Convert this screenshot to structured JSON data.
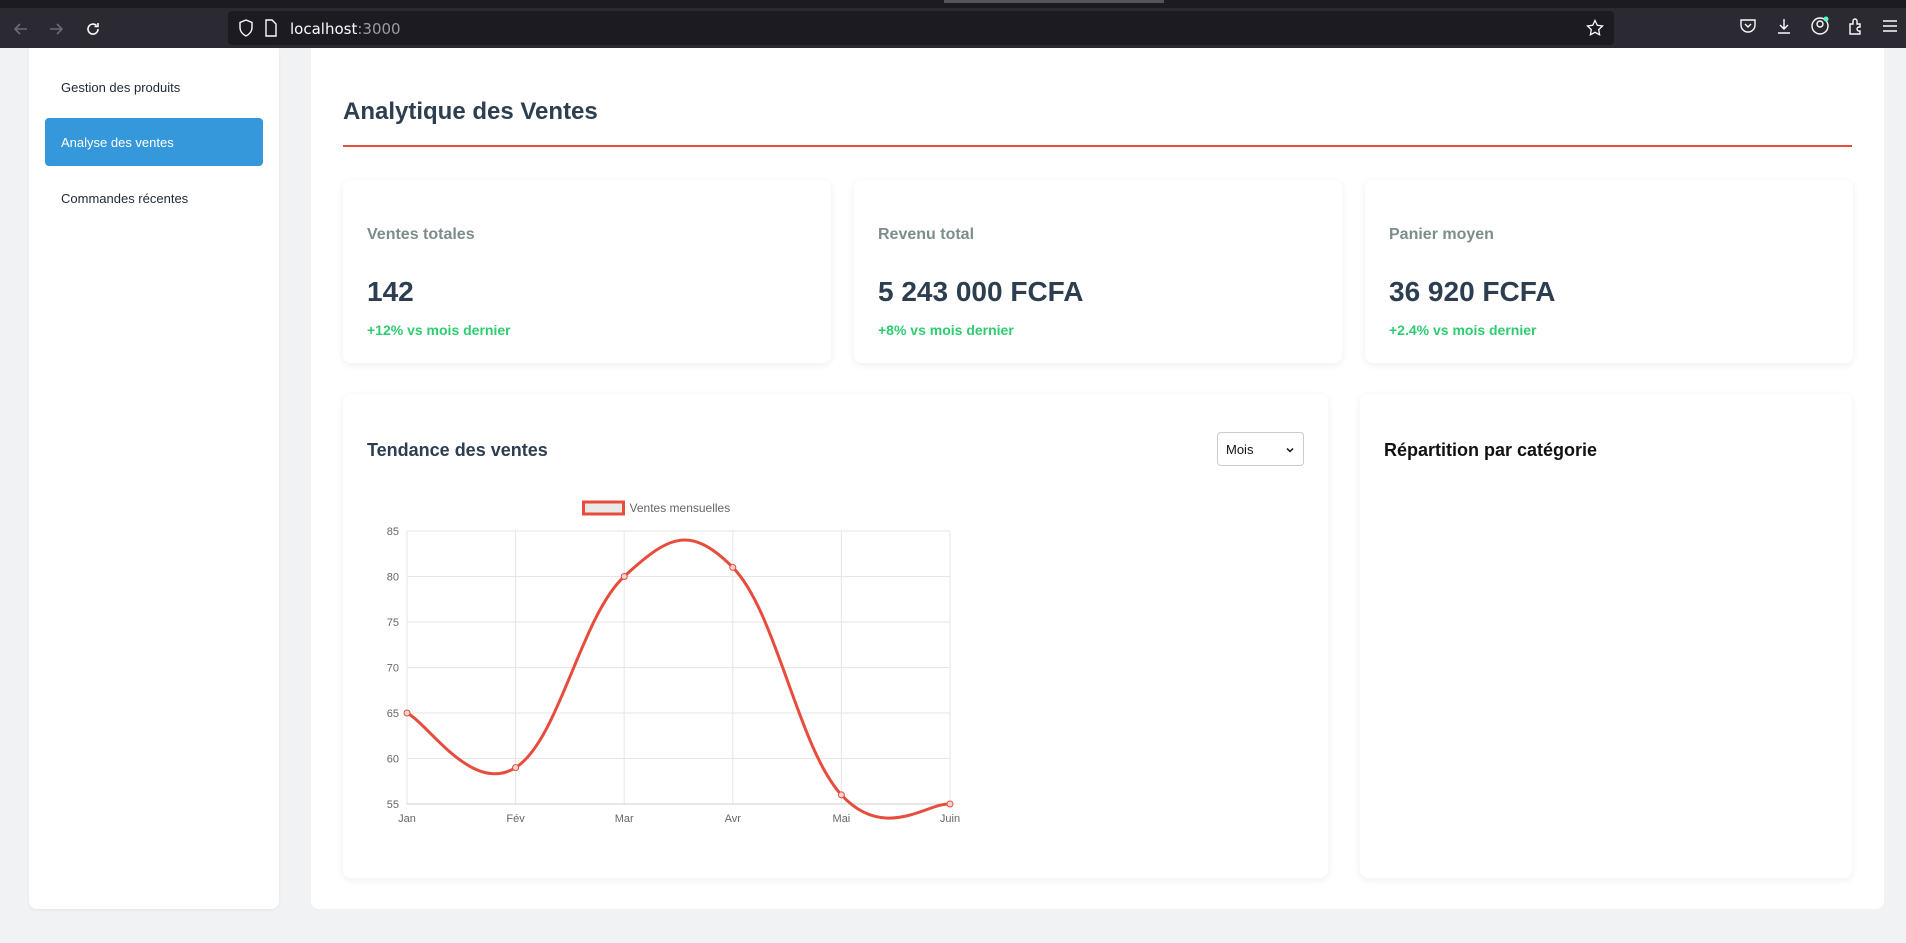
{
  "browser": {
    "url_host": "localhost",
    "url_port": ":3000"
  },
  "sidebar": {
    "items": [
      {
        "label": "Gestion des produits",
        "active": false
      },
      {
        "label": "Analyse des ventes",
        "active": true
      },
      {
        "label": "Commandes récentes",
        "active": false
      }
    ]
  },
  "main": {
    "title": "Analytique des Ventes",
    "stats": [
      {
        "label": "Ventes totales",
        "value": "142",
        "change": "+12% vs mois dernier"
      },
      {
        "label": "Revenu total",
        "value": "5 243 000 FCFA",
        "change": "+8% vs mois dernier"
      },
      {
        "label": "Panier moyen",
        "value": "36 920 FCFA",
        "change": "+2.4% vs mois dernier"
      }
    ],
    "trend_panel": {
      "title": "Tendance des ventes",
      "period_select": "Mois"
    },
    "category_panel": {
      "title": "Répartition par catégorie"
    }
  },
  "colors": {
    "accent": "#3498db",
    "rule": "#e74c3c",
    "positive": "#2ecc71",
    "line": "#e74c3c"
  },
  "chart_data": {
    "type": "line",
    "categories": [
      "Jan",
      "Fév",
      "Mar",
      "Avr",
      "Mai",
      "Juin"
    ],
    "series": [
      {
        "name": "Ventes mensuelles",
        "values": [
          65,
          59,
          80,
          81,
          56,
          55
        ]
      }
    ],
    "ylim": [
      55,
      85
    ],
    "yticks": [
      55,
      60,
      65,
      70,
      75,
      80,
      85
    ],
    "grid": true,
    "legend": "top-center"
  }
}
